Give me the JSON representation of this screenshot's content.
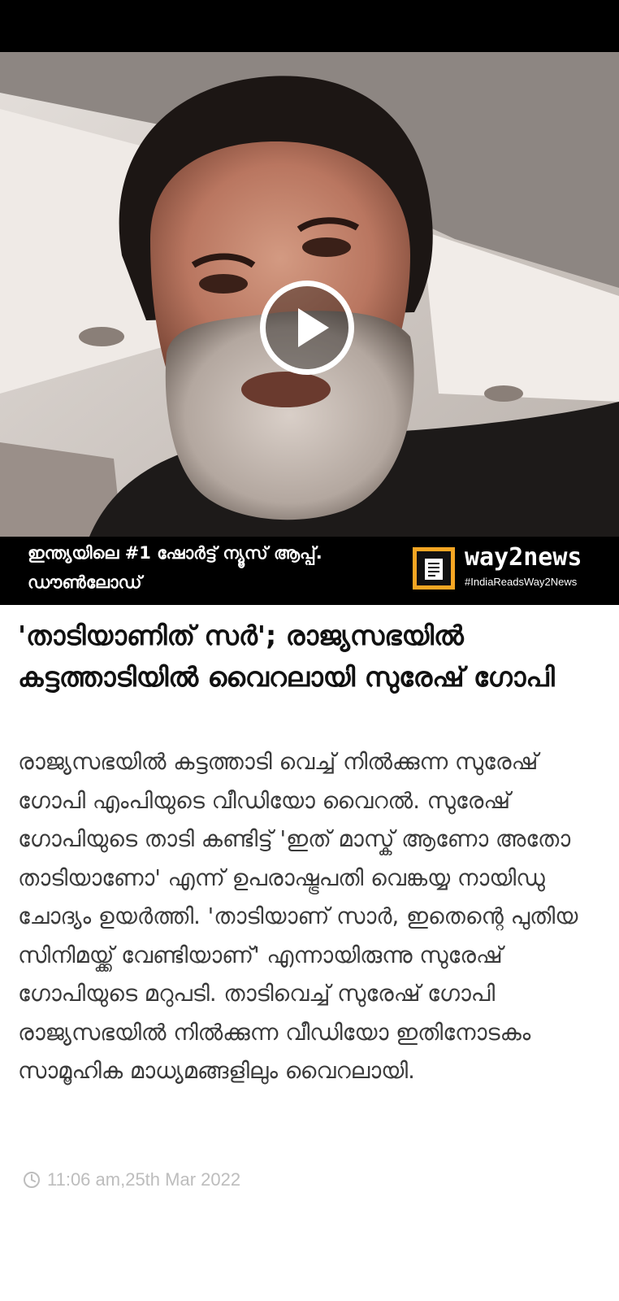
{
  "hero": {
    "media_type": "video",
    "play_icon": "play-icon"
  },
  "promo_banner": {
    "line1": "ഇന്ത്യയിലെ #1 ഷോർട്ട് ന്യൂസ് ആപ്പ്.",
    "line2": "ഡൗൺലോഡ്",
    "brand_name": "way2news",
    "brand_tag": "#IndiaReadsWay2News",
    "logo_icon": "newspaper-icon",
    "brand_accent": "#f5a623"
  },
  "article": {
    "headline": "'താടിയാണിത് സർ'; രാജ്യസഭയിൽ കട്ടത്താടിയിൽ വൈറലായി സുരേഷ് ഗോപി",
    "body": "രാജ്യസഭയിൽ കട്ടത്താടി വെച്ച് നിൽക്കുന്ന സുരേഷ് ഗോപി എംപിയുടെ വീഡിയോ വൈറൽ. സുരേഷ് ഗോപിയുടെ താടി കണ്ടിട്ട് 'ഇത് മാസ്ക് ആണോ അതോ താടിയാണോ' എന്ന് ഉപരാഷ്ട്രപതി വെങ്കയ്യ നായിഡു ചോദ്യം ഉയർത്തി. 'താടിയാണ് സാർ, ഇതെന്റെ പുതിയ സിനിമയ്ക്ക് വേണ്ടിയാണ്' എന്നായിരുന്നു സുരേഷ് ഗോപിയുടെ മറുപടി. താടിവെച്ച് സുരേഷ് ഗോപി രാജ്യസഭയിൽ നിൽക്കുന്ന വീഡിയോ ഇതിനോടകം സാമൂഹിക മാധ്യമങ്ങളിലും വൈറലായി.",
    "timestamp": "11:06 am,25th Mar 2022",
    "timestamp_icon": "clock-icon"
  }
}
